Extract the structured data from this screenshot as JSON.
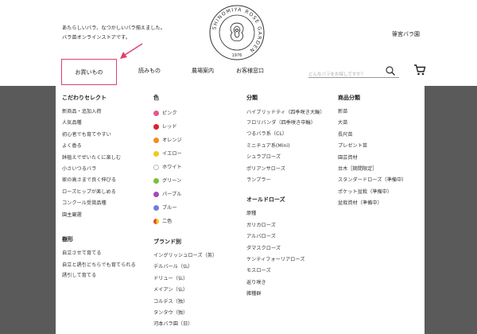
{
  "header": {
    "tagline_line1": "あたらしいバラ、なつかしいバラ揃えました。",
    "tagline_line2": "バラ苗オンラインストアです。",
    "logo_text": "SHINOMIYA ROSE GARDEN",
    "logo_year": "1976",
    "site_name": "篠宮バラ園"
  },
  "nav": {
    "shop": "お買いもの",
    "read": "読みもの",
    "farm": "農場案内",
    "contact": "お客様窓口",
    "search_placeholder": "どんなバラをお探しですか？"
  },
  "menu": {
    "selection": {
      "heading": "こだわりセレクト",
      "items": [
        "新商品・追加入荷",
        "人気品種",
        "初心者でも育てやすい",
        "よく香る",
        "鉢植えでぜいたくに楽しむ",
        "小さいつるバラ",
        "家の高さまで良く伸びる",
        "ローズヒップが楽しめる",
        "コンクール受賞品種",
        "園主厳選"
      ]
    },
    "form": {
      "heading": "樹形",
      "items": [
        "自立させて育てる",
        "自立と誘引どちらでも育てられる",
        "誘引して育てる"
      ]
    },
    "color": {
      "heading": "色",
      "items": [
        {
          "label": "ピンク",
          "color": "#e8578f"
        },
        {
          "label": "レッド",
          "color": "#d9232e"
        },
        {
          "label": "オレンジ",
          "color": "#f08c1c"
        },
        {
          "label": "イエロー",
          "color": "#f2c81b"
        },
        {
          "label": "ホワイト",
          "color": "#ffffff"
        },
        {
          "label": "グリーン",
          "color": "#7bbf3a"
        },
        {
          "label": "パープル",
          "color": "#a04cb5"
        },
        {
          "label": "ブルー",
          "color": "#6f7fd6"
        },
        {
          "label": "二色",
          "color": "#e04a2a"
        }
      ]
    },
    "brand": {
      "heading": "ブランド別",
      "items": [
        "イングリッシュローズ（英）",
        "デルバール（仏）",
        "ドリュー（仏）",
        "メイアン（仏）",
        "コルデス（独）",
        "タンタウ（独）",
        "河本バラ園（日）"
      ]
    },
    "classification": {
      "heading": "分類",
      "items": [
        "ハイブリッドティ（四季咲き大輪）",
        "フロリバンダ（四季咲き中輪）",
        "つるバラ系（CL）",
        "ミニチュア系(Mini)",
        "シュラブローズ",
        "ポリアンサローズ",
        "ランブラー"
      ]
    },
    "oldrose": {
      "heading": "オールドローズ",
      "items": [
        "原種",
        "ガリカローズ",
        "アルバローズ",
        "ダマスクローズ",
        "ケンティフォーリアローズ",
        "モスローズ",
        "返り咲き",
        "雑種群"
      ]
    },
    "product": {
      "heading": "商品分類",
      "items": [
        "新苗",
        "大苗",
        "長尺苗",
        "プレゼント苗",
        "園芸資材",
        "台木［期間限定］",
        "スタンダードローズ（準備中）",
        "ポケット盆栽（準備中）",
        "盆栽資材（準備中）"
      ]
    }
  }
}
